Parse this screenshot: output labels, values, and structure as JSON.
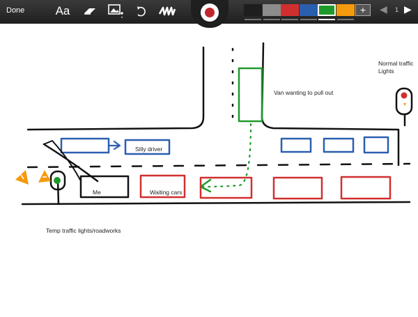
{
  "toolbar": {
    "done_label": "Done",
    "text_tool_label": "Aa",
    "record_color": "#c0272d",
    "colors": [
      {
        "name": "black",
        "hex": "#1e1e1e"
      },
      {
        "name": "gray",
        "hex": "#8c8c8c"
      },
      {
        "name": "red",
        "hex": "#d12f2f"
      },
      {
        "name": "blue",
        "hex": "#2a5fb0"
      },
      {
        "name": "green",
        "hex": "#1f9a2a"
      },
      {
        "name": "orange",
        "hex": "#f59a0e"
      }
    ],
    "selected_color": "green",
    "add_color_label": "+",
    "page_number": "1"
  },
  "drawing": {
    "labels": {
      "van": "Van wanting to pull out",
      "normal_lights_line1": "Normal traffic",
      "normal_lights_line2": "Lights",
      "silly_driver": "Silly driver",
      "me": "Me",
      "waiting_cars": "Waiting cars",
      "temp_lights": "Temp traffic lights/roadworks"
    }
  }
}
